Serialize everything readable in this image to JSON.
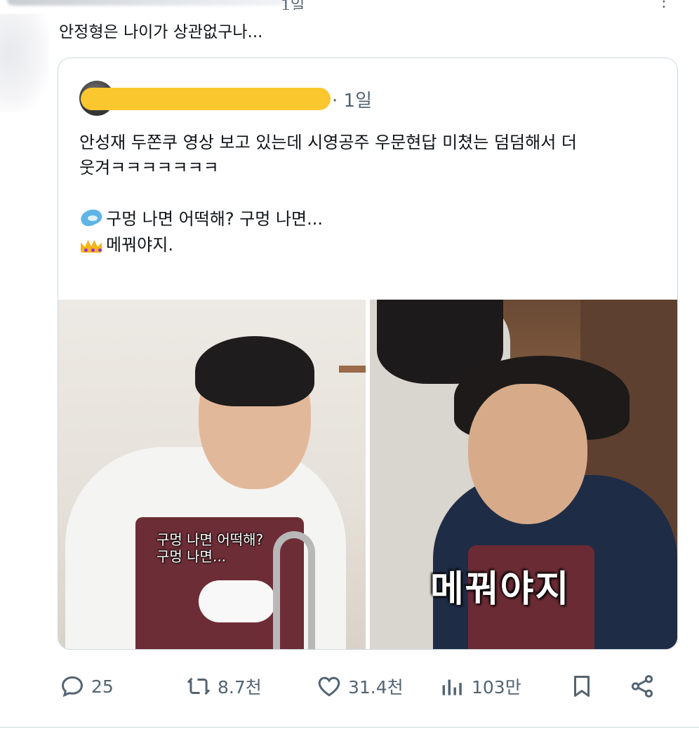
{
  "tweet": {
    "text": "안정형은 나이가 상관없구나..."
  },
  "quote": {
    "date": "· 1일",
    "lines": [
      "안성재 두쫀쿠 영상 보고 있는데 시영공주 우문현답 미쳤는 덤덤해서 더",
      "웃겨ㅋㅋㅋㅋㅋㅋㅋ",
      "",
      "구멍 나면 어떡해? 구멍 나면...",
      "메꿔야지."
    ],
    "media": {
      "left_caption_1": "구멍 나면 어떡해?",
      "left_caption_2": "구멍 나면...",
      "right_caption": "메꿔야지"
    }
  },
  "actions": {
    "reply_count": "25",
    "retweet_count": "8.7천",
    "like_count": "31.4천",
    "view_count": "103만"
  }
}
